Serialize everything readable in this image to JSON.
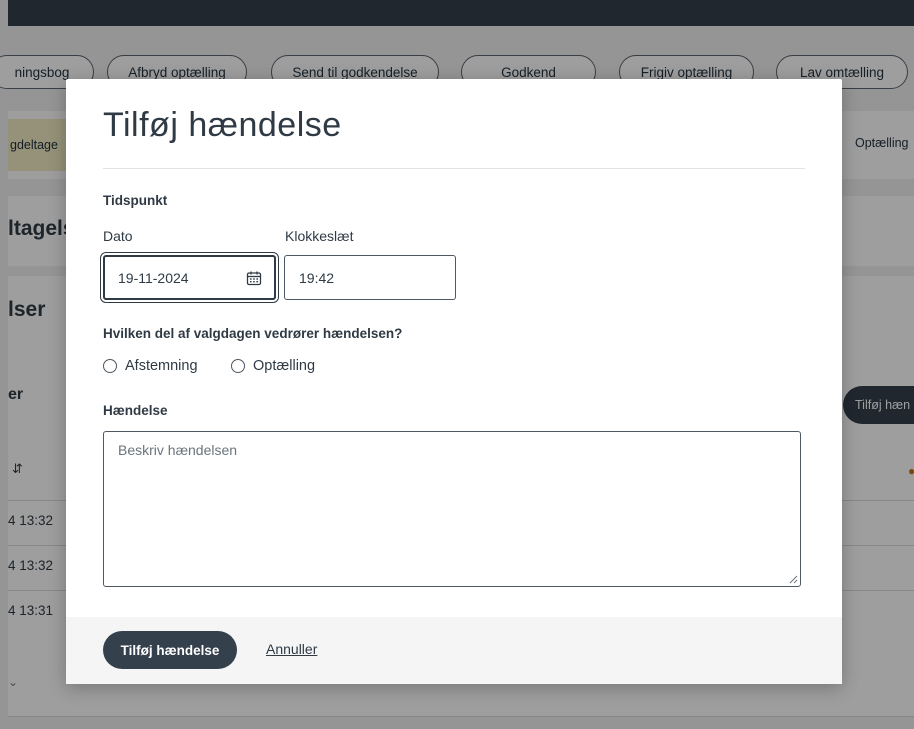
{
  "background": {
    "actions": [
      "ningsbog",
      "Afbryd optælling",
      "Send til godkendelse",
      "Godkend",
      "Frigiv optælling",
      "Lav omtælling"
    ],
    "tab_left": "gdeltage",
    "tab_right": "Optælling",
    "section1_heading": "ltagels",
    "section2_heading": "lser",
    "section3_heading": "er",
    "add_event_button": "Tilføj hæn",
    "sort_icon": "sort-icon",
    "rows": [
      "4 13:32",
      "4 13:32",
      "4 13:31"
    ]
  },
  "modal": {
    "title": "Tilføj hændelse",
    "timepoint_label": "Tidspunkt",
    "date_label": "Dato",
    "date_value": "19-11-2024",
    "time_label": "Klokkeslæt",
    "time_value": "19:42",
    "part_question": "Hvilken del af valgdagen vedrører hændelsen?",
    "radio_options": [
      "Afstemning",
      "Optælling"
    ],
    "event_label": "Hændelse",
    "event_placeholder": "Beskriv hændelsen",
    "submit_label": "Tilføj hændelse",
    "cancel_label": "Annuller"
  },
  "colors": {
    "primary": "#34404c",
    "tag": "#f1ecc4",
    "overlay": "rgba(0,0,0,0.38)"
  }
}
